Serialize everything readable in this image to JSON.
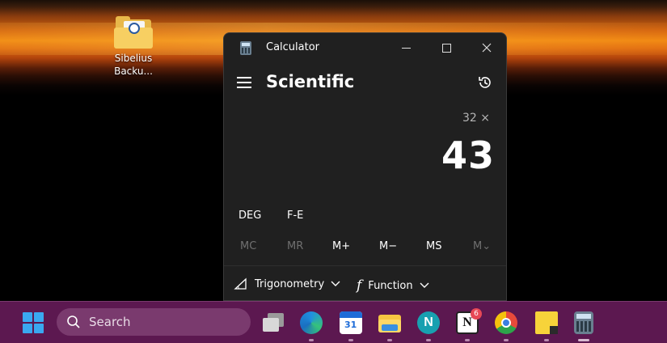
{
  "desktop": {
    "icon_label": "Sibelius Backu..."
  },
  "window": {
    "title": "Calculator",
    "mode": "Scientific",
    "expression": "32 ×",
    "result": "43",
    "toggles": {
      "angle": "DEG",
      "fe": "F-E"
    },
    "memory": [
      "MC",
      "MR",
      "M+",
      "M−",
      "MS",
      "M⌄"
    ],
    "functions": {
      "trig": "Trigonometry",
      "func": "Function"
    }
  },
  "taskbar": {
    "search_placeholder": "Search",
    "notion_badge": "6"
  },
  "colors": {
    "window_bg": "#202020",
    "taskbar_bg": "#5c1850",
    "accent": "#3aa8f0"
  }
}
